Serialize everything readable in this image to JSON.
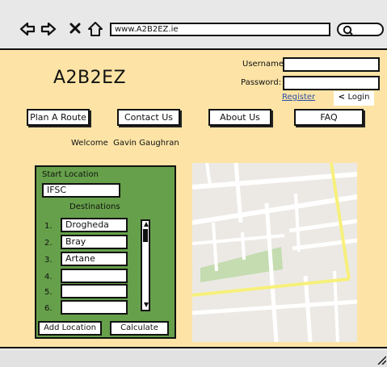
{
  "browser": {
    "url": "www.A2B2EZ.ie"
  },
  "header": {
    "logo": "A2B2EZ",
    "username_label": "Username:",
    "password_label": "Password:",
    "register_link": "Register",
    "login_button": "Login"
  },
  "nav": {
    "plan": "Plan A Route",
    "contact": "Contact Us",
    "about": "About Us",
    "faq": "FAQ"
  },
  "welcome": "Welcome  Gavin Gaughran",
  "planner": {
    "start_label": "Start Location",
    "start_value": "IFSC",
    "destinations_label": "Destinations",
    "destinations": [
      {
        "num": "1.",
        "value": "Drogheda"
      },
      {
        "num": "2.",
        "value": "Bray"
      },
      {
        "num": "3.",
        "value": "Artane"
      },
      {
        "num": "4.",
        "value": ""
      },
      {
        "num": "5.",
        "value": ""
      },
      {
        "num": "6.",
        "value": ""
      }
    ],
    "add_button": "Add Location",
    "calculate_button": "Calculate"
  },
  "colors": {
    "page_bg": "#fde4a6",
    "panel_green": "#66a04a",
    "map_bg": "#ece9e4",
    "map_road_yellow": "#f7f07a",
    "map_park": "#c4dcb0"
  }
}
